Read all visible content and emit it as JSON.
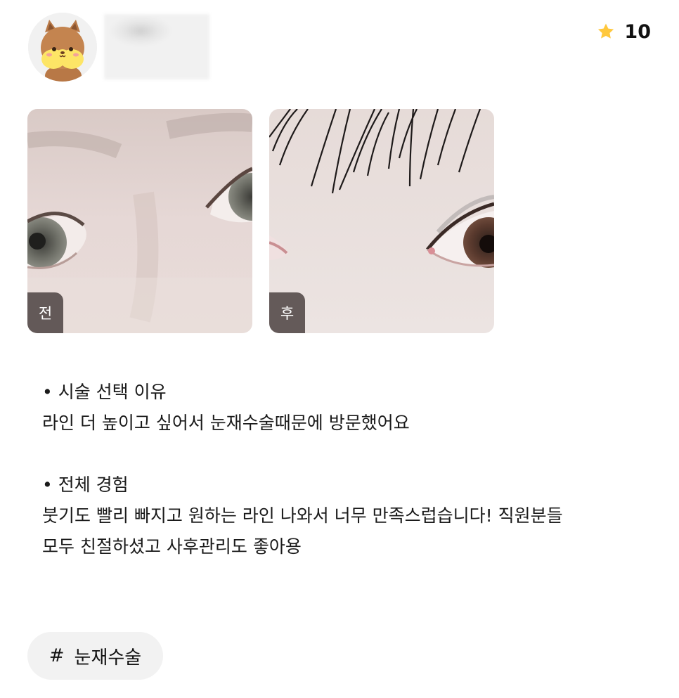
{
  "profile": {
    "avatar": "squirrel-avatar-icon",
    "rating_icon": "star-icon",
    "rating_value": "10"
  },
  "photos": [
    {
      "label": "전"
    },
    {
      "label": "후"
    }
  ],
  "review": {
    "section1_title": "• 시술 선택 이유",
    "section1_body": "라인 더 높이고 싶어서 눈재수술때문에 방문했어요",
    "section2_title": "• 전체 경험",
    "section2_body_line1": "붓기도 빨리 빠지고 원하는 라인 나와서 너무 만족스럽습니다! 직원분들",
    "section2_body_line2": "모두 친절하셨고 사후관리도 좋아용"
  },
  "hashtag": {
    "symbol": "#",
    "label": "눈재수술"
  },
  "colors": {
    "star": "#FFC83D",
    "tag_bg": "#463C3A",
    "chip_bg": "#F2F2F2"
  }
}
